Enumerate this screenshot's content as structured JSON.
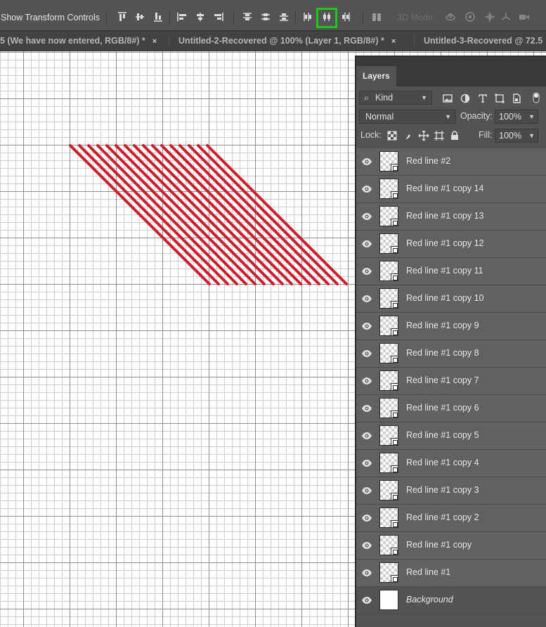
{
  "options_bar": {
    "show_transform_label": "Show Transform Controls",
    "mode_3d_label": "3D Mode:",
    "buttons": [
      "align-top-icon",
      "align-vertical-center-icon",
      "align-bottom-icon",
      "align-left-icon",
      "align-horizontal-center-icon",
      "align-right-icon",
      "distribute-top-icon",
      "distribute-vertical-center-icon",
      "distribute-bottom-icon",
      "distribute-left-icon",
      "distribute-horizontal-center-icon",
      "distribute-right-icon",
      "auto-align-icon"
    ],
    "highlighted_button": "distribute-horizontal-center-icon",
    "highlight_color": "#1ec81e"
  },
  "tabs": [
    {
      "label": "5 (We have now entered, RGB/8#) *",
      "close": "×"
    },
    {
      "label": "Untitled-2-Recovered @ 100% (Layer 1, RGB/8#) *",
      "close": "×"
    },
    {
      "label": "Untitled-3-Recovered @ 72.5",
      "close": ""
    }
  ],
  "canvas": {
    "stripe_color": "#cc1f2e",
    "stripe_count": 16
  },
  "layers_panel": {
    "tab_label": "Layers",
    "filter_kind": "Kind",
    "blend_mode": "Normal",
    "opacity_label": "Opacity:",
    "opacity_value": "100%",
    "lock_label": "Lock:",
    "fill_label": "Fill:",
    "fill_value": "100%",
    "layers": [
      {
        "name": "Red line #2",
        "type": "smart"
      },
      {
        "name": "Red line #1 copy 14",
        "type": "smart"
      },
      {
        "name": "Red line #1 copy 13",
        "type": "smart"
      },
      {
        "name": "Red line #1 copy 12",
        "type": "smart"
      },
      {
        "name": "Red line #1 copy 11",
        "type": "smart"
      },
      {
        "name": "Red line #1 copy 10",
        "type": "smart"
      },
      {
        "name": "Red line #1 copy 9",
        "type": "smart"
      },
      {
        "name": "Red line #1 copy 8",
        "type": "smart"
      },
      {
        "name": "Red line #1 copy 7",
        "type": "smart"
      },
      {
        "name": "Red line #1 copy 6",
        "type": "smart"
      },
      {
        "name": "Red line #1 copy 5",
        "type": "smart"
      },
      {
        "name": "Red line #1 copy 4",
        "type": "smart"
      },
      {
        "name": "Red line #1 copy 3",
        "type": "smart"
      },
      {
        "name": "Red line #1 copy 2",
        "type": "smart"
      },
      {
        "name": "Red line #1 copy",
        "type": "smart"
      },
      {
        "name": "Red line #1",
        "type": "smart"
      },
      {
        "name": "Background",
        "type": "background"
      }
    ]
  }
}
